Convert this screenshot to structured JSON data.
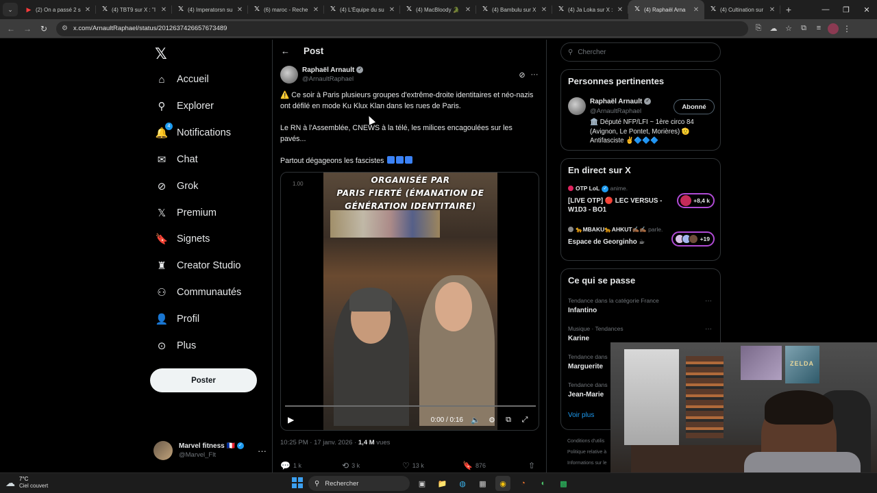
{
  "browser": {
    "tabs": [
      {
        "title": "(2) On a passé 2 s",
        "favicon": "youtube-icon",
        "active": false
      },
      {
        "title": "(4) TBT9 sur X : \"I",
        "favicon": "x-icon",
        "active": false
      },
      {
        "title": "(4) Imperatorsn su",
        "favicon": "x-icon",
        "active": false
      },
      {
        "title": "(6) maroc - Reche",
        "favicon": "x-icon",
        "active": false
      },
      {
        "title": "(4) L'Équipe du su",
        "favicon": "x-icon",
        "active": false
      },
      {
        "title": "(4) MacBloody 🐊",
        "favicon": "x-icon",
        "active": false
      },
      {
        "title": "(4) Bambulu sur X",
        "favicon": "x-icon",
        "active": false
      },
      {
        "title": "(4) Ja Loka sur X :",
        "favicon": "x-icon",
        "active": false
      },
      {
        "title": "(4) Raphaël Arna",
        "favicon": "x-icon",
        "active": true
      },
      {
        "title": "(4) Cultination sur",
        "favicon": "x-icon",
        "active": false
      }
    ],
    "url": "x.com/ArnaultRaphael/status/2012637426657673489"
  },
  "leftnav": {
    "items": [
      {
        "label": "Accueil",
        "icon": "home-icon",
        "glyph": "⌂"
      },
      {
        "label": "Explorer",
        "icon": "search-icon",
        "glyph": "⚲"
      },
      {
        "label": "Notifications",
        "icon": "bell-icon",
        "glyph": "🔔",
        "badge": "4"
      },
      {
        "label": "Chat",
        "icon": "mail-icon",
        "glyph": "✉"
      },
      {
        "label": "Grok",
        "icon": "grok-icon",
        "glyph": "⊘"
      },
      {
        "label": "Premium",
        "icon": "x-premium-icon",
        "glyph": "𝕏"
      },
      {
        "label": "Signets",
        "icon": "bookmark-icon",
        "glyph": "🔖"
      },
      {
        "label": "Creator Studio",
        "icon": "creator-icon",
        "glyph": "♜"
      },
      {
        "label": "Communautés",
        "icon": "communities-icon",
        "glyph": "⚇"
      },
      {
        "label": "Profil",
        "icon": "profile-icon",
        "glyph": "👤"
      },
      {
        "label": "Plus",
        "icon": "more-circle-icon",
        "glyph": "⊙"
      }
    ],
    "post_button": "Poster",
    "account": {
      "name": "Marvel fitness 🇫🇷",
      "handle": "@Marvel_Flt"
    }
  },
  "post": {
    "header": "Post",
    "author_name": "Raphaël Arnault",
    "author_handle": "@ArnaultRaphael",
    "paragraph1": "Ce soir à Paris plusieurs groupes d'extrême-droite identitaires et néo-nazis ont défilé en mode Ku Klux Klan dans les rues de Paris.",
    "paragraph2": "Le RN à l'Assemblée, CNEWS à la télé, les milices encagoulées sur les pavés...",
    "paragraph3": "Partout dégageons les fascistes",
    "video": {
      "caption_line1": "ORGANISÉE PAR",
      "caption_line2": "PARIS FIERTÉ (ÉMANATION DE",
      "caption_line3": "GÉNÉRATION IDENTITAIRE)",
      "speed": "1.00",
      "time": "0:00 / 0:16",
      "progress": 0
    },
    "timestamp": "10:25 PM · 17 janv. 2026 · ",
    "views_count": "1,4 M",
    "views_label": " vues",
    "replies": "1 k",
    "reposts": "3 k",
    "likes": "13 k",
    "bookmarks": "876"
  },
  "right": {
    "search_placeholder": "Chercher",
    "relevant": {
      "heading": "Personnes pertinentes",
      "name": "Raphaël Arnault",
      "handle": "@ArnaultRaphael",
      "follow_label": "Abonné",
      "bio": "🏛️ Député NFP/LFI ~ 1ère circo 84 (Avignon, Le Pontet, Morières) 🫡 Antifasciste ✌️🔷🔷🔷"
    },
    "live": {
      "heading": "En direct sur X",
      "items": [
        {
          "host": "OTP LoL",
          "status": " anime.",
          "title": "[LIVE OTP] 🔴 LEC VERSUS - W1D3 - BO1",
          "count": "+8,4 k"
        },
        {
          "host": "🐆MBAKU🐆AHKUT✍🏾✍🏾",
          "status": " parle.",
          "title": "Espace de Georginho ☕",
          "count": "+19"
        }
      ]
    },
    "trends": {
      "heading": "Ce qui se passe",
      "items": [
        {
          "context": "Tendance dans la catégorie France",
          "title": "Infantino"
        },
        {
          "context": "Musique · Tendances",
          "title": "Karine"
        },
        {
          "context": "Tendance dans",
          "title": "Marguerite"
        },
        {
          "context": "Tendance dans",
          "title": "Jean-Marie"
        }
      ],
      "see_more": "Voir plus"
    },
    "footer": [
      "Conditions d'utilis",
      "Politique relative à",
      "Informations sur le"
    ]
  },
  "webcam": {
    "poster_text": "ZELDA"
  },
  "taskbar": {
    "temperature": "7°C",
    "weather": "Ciel couvert",
    "search_label": "Rechercher"
  }
}
